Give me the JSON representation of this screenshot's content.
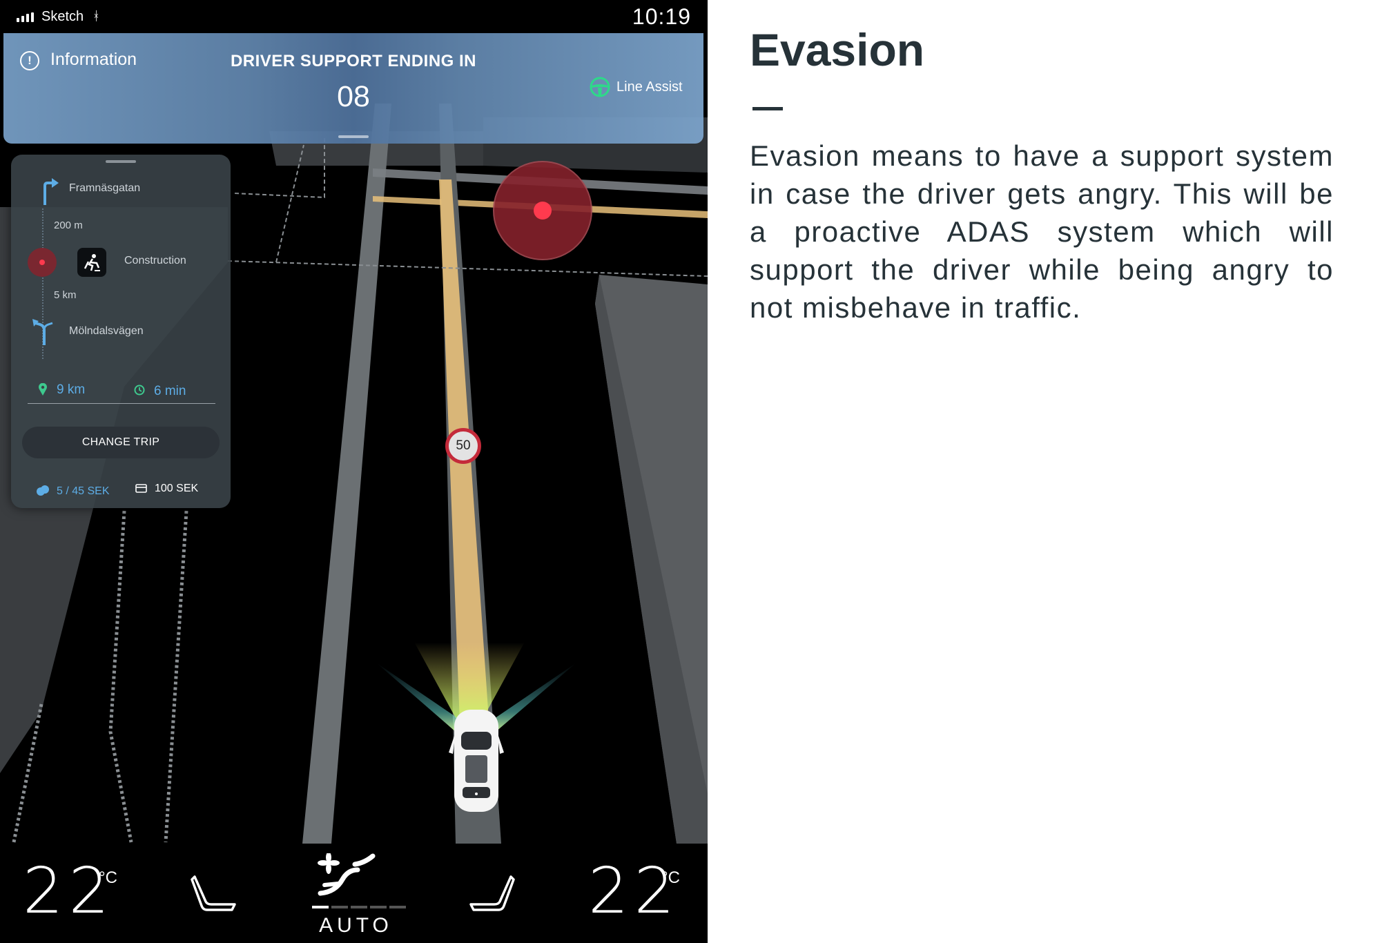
{
  "status_bar": {
    "carrier": "Sketch",
    "time": "10:19"
  },
  "banner": {
    "info_label": "Information",
    "title": "DRIVER SUPPORT ENDING IN",
    "countdown": "08",
    "line_assist_label": "Line Assist",
    "line_assist_color": "#2ed98a"
  },
  "trip": {
    "steps": [
      {
        "label": "Framnäsgatan",
        "icon": "turn-right-icon"
      },
      {
        "label": "200 m"
      },
      {
        "label": "Construction",
        "icon": "construction-icon"
      },
      {
        "label": "5 km"
      },
      {
        "label": "Mölndalsvägen",
        "icon": "fork-left-icon"
      }
    ],
    "remaining_distance": "9 km",
    "remaining_time": "6 min",
    "change_trip_label": "CHANGE TRIP",
    "fare": "5 / 45 SEK",
    "card_amount": "100 SEK",
    "accent_color": "#5dade6"
  },
  "map": {
    "speed_limit": "50",
    "hazard_color": "#ff3a4e",
    "route_color": "#e7c07a"
  },
  "climate": {
    "left_temp": "22",
    "left_unit": "°C",
    "right_temp": "22",
    "right_unit": "°C",
    "fan_mode": "AUTO",
    "fan_level": 0.2
  },
  "article": {
    "title": "Evasion",
    "body": "Evasion means to have a support system in case the driver gets angry. This will be a proactive ADAS system which will support the driver while being angry to not misbehave in traffic."
  }
}
